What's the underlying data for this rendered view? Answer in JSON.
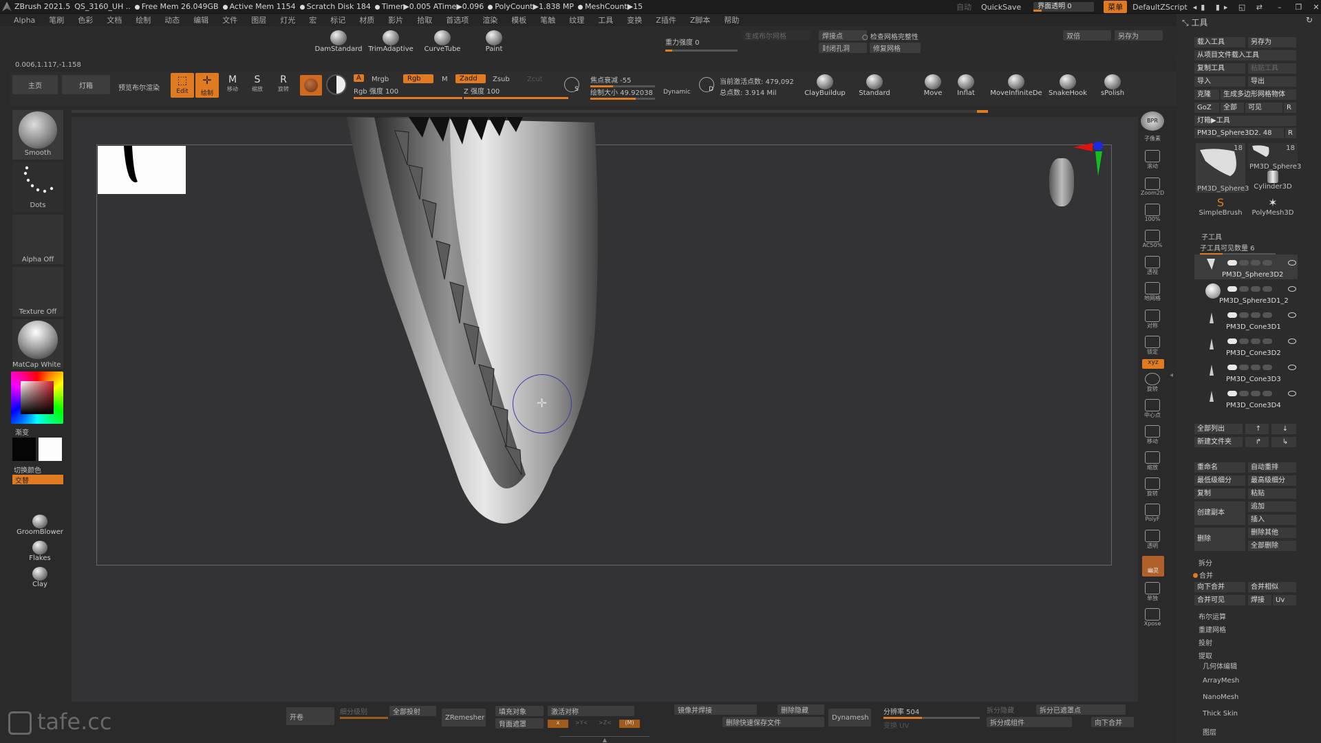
{
  "titlebar": {
    "app": "ZBrush 2021.5",
    "doc": "QS_3160_UH ..",
    "stats": [
      "Free Mem 26.049GB",
      "Active Mem 1154",
      "Scratch Disk 184",
      "Timer▶0.005 ATime▶0.096",
      "PolyCount▶1.838 MP",
      "MeshCount▶15"
    ],
    "auto": "自动",
    "quicksave": "QuickSave",
    "transparency": "界面透明 0",
    "menu_btn": "菜单",
    "default_script": "DefaultZScript"
  },
  "menubar": [
    "Alpha",
    "笔刷",
    "色彩",
    "文档",
    "绘制",
    "动态",
    "编辑",
    "文件",
    "图层",
    "灯光",
    "宏",
    "标记",
    "材质",
    "影片",
    "拾取",
    "首选项",
    "渲染",
    "模板",
    "笔触",
    "纹理",
    "工具",
    "变换",
    "Z插件",
    "Z脚本",
    "帮助"
  ],
  "coords": "0.006,1.117,-1.158",
  "top_brushes": [
    {
      "label": "DamStandard"
    },
    {
      "label": "TrimAdaptive"
    },
    {
      "label": "CurveTube"
    },
    {
      "label": "Paint"
    }
  ],
  "gravity": "重力强度 0",
  "geom_top": {
    "generate_mesh": "生成布尔网格",
    "weld_points": "焊接点",
    "check_mesh": "检查网格完整性",
    "close_holes": "封闭孔洞",
    "repair_mesh": "修复网格",
    "double": "双倍",
    "save_as": "另存为"
  },
  "shelf": {
    "home": "主页",
    "lightbox": "灯箱",
    "preview_boolean": "预览布尔渲染",
    "edit": "Edit",
    "draw": "绘制",
    "move": "移动",
    "scale": "缩放",
    "rotate": "旋转",
    "a": "A",
    "mrgb": "Mrgb",
    "rgb": "Rgb",
    "m": "M",
    "rgb_intensity": "Rgb 强度 100",
    "zadd": "Zadd",
    "zsub": "Zsub",
    "zcut": "Zcut",
    "z_intensity": "Z 强度 100",
    "focal_shift": "焦点衰减 -55",
    "draw_size": "绘制大小 49.92038",
    "dynamic": "Dynamic",
    "active_points": "当前激活点数: 479,092",
    "total_points": "总点数: 3.914 Mil",
    "s": "S",
    "d": "D"
  },
  "shelf_brushes": [
    {
      "label": "ClayBuildup"
    },
    {
      "label": "Standard"
    },
    {
      "label": "Move"
    },
    {
      "label": "Inflat"
    },
    {
      "label": "MoveInfiniteDe"
    },
    {
      "label": "SnakeHook"
    },
    {
      "label": "sPolish"
    }
  ],
  "left_panel": {
    "smooth": "Smooth",
    "dots": "Dots",
    "alpha_off": "Alpha Off",
    "texture_off": "Texture Off",
    "matcap": "MatCap White C",
    "gradient": "渐变",
    "switch_color": "切换颜色",
    "alternate": "交替",
    "groomblower": "GroomBlower",
    "flakes": "Flakes",
    "clay": "Clay"
  },
  "right_toolbar": [
    "BPR",
    "子像素",
    "滚动",
    "Zoom2D",
    "100%",
    "AC50%",
    "透视",
    "地网格",
    "对称",
    "锁定",
    "xyz",
    "旋转",
    "中心点",
    "移动",
    "缩放",
    "旋转",
    "PolyF",
    "透明",
    "幽灵",
    "单独",
    "Xpose"
  ],
  "tool_panel": {
    "header": "工具",
    "load_tool": "载入工具",
    "save_as": "另存为",
    "load_from_project": "从项目文件载入工具",
    "copy_tool": "复制工具",
    "paste_tool": "粘贴工具",
    "import": "导入",
    "export": "导出",
    "clone": "克隆",
    "make_polymesh": "生成多边形网格物体",
    "goz": "GoZ",
    "all": "全部",
    "visible": "可见",
    "r": "R",
    "lightbox_tool": "灯箱▶工具",
    "current_tool": "PM3D_Sphere3D2. 48",
    "r2": "R",
    "thumb_main": "PM3D_Sphere3",
    "thumb_main_count": "18",
    "thumb_2": "PM3D_Sphere3",
    "thumb_2_count": "18",
    "thumb_3": "Cylinder3D",
    "thumb_4": "SimpleBrush",
    "thumb_5": "PolyMesh3D"
  },
  "subtool": {
    "header": "子工具",
    "visible_count": "子工具可见数量 6",
    "items": [
      "PM3D_Sphere3D2",
      "PM3D_Sphere3D1_2",
      "PM3D_Cone3D1",
      "PM3D_Cone3D2",
      "PM3D_Cone3D3",
      "PM3D_Cone3D4"
    ],
    "list_all": "全部列出",
    "new_folder": "新建文件夹",
    "rename": "重命名",
    "auto_reorder": "自动重排",
    "lowest_subdiv": "最低级细分",
    "highest_subdiv": "最高级细分",
    "copy": "复制",
    "paste": "粘贴",
    "duplicate": "创建副本",
    "append": "追加",
    "insert": "插入",
    "delete": "删除",
    "delete_other": "删除其他",
    "delete_all": "全部删除",
    "split": "拆分",
    "merge": "合并",
    "merge_down": "向下合并",
    "merge_similar": "合并相似",
    "merge_visible": "合并可见",
    "weld": "焊接",
    "uv": "Uv",
    "boolean": "布尔运算",
    "remesh": "重建网格",
    "project": "投射",
    "extract": "提取"
  },
  "right_sections": [
    "几何体编辑",
    "ArrayMesh",
    "NanoMesh",
    "Thick Skin",
    "图层"
  ],
  "bottom": {
    "open": "开卷",
    "subdiv_level": "细分级别",
    "project_all": "全部投射",
    "zremesher": "ZRemesher",
    "fill_object": "填充对象",
    "activate_symmetry": "激活对称",
    "backface_mask": "背面遮罩",
    "x": "x",
    "y": ">Y<",
    "z": ">Z<",
    "m": "(M)",
    "mirror_weld": "镜像并焊接",
    "delete_hidden": "删除隐藏",
    "dynamesh": "Dynamesh",
    "resolution": "分辨率 504",
    "del_quicksave": "删除快速保存文件",
    "poly_uv": "变换 UV",
    "split_hidden": "拆分隐藏",
    "split_masked": "拆分已遮罩点",
    "split_groups": "拆分成组件",
    "merge_down": "向下合并"
  },
  "watermark": "tafe.cc"
}
